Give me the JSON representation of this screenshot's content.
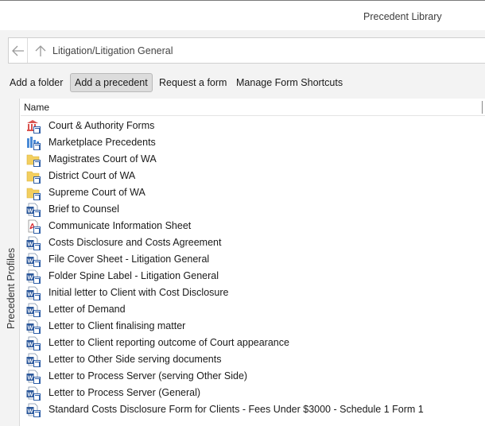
{
  "window": {
    "title": "Precedent Library"
  },
  "address": {
    "path": "Litigation/Litigation General"
  },
  "toolbar": {
    "add_folder": "Add a folder",
    "add_precedent": "Add a precedent",
    "request_form": "Request a form",
    "manage_shortcuts": "Manage Form Shortcuts"
  },
  "side_panel": {
    "label": "Precedent Profiles"
  },
  "list": {
    "column_name": "Name",
    "items": [
      {
        "label": "Court & Authority Forms",
        "icon": "court-building-icon"
      },
      {
        "label": "Marketplace Precedents",
        "icon": "marketplace-icon"
      },
      {
        "label": "Magistrates Court of WA",
        "icon": "folder-shortcut-icon"
      },
      {
        "label": "District Court of WA",
        "icon": "folder-shortcut-icon"
      },
      {
        "label": "Supreme Court of WA",
        "icon": "folder-shortcut-icon"
      },
      {
        "label": "Brief to Counsel",
        "icon": "word-doc-icon"
      },
      {
        "label": "Communicate Information Sheet",
        "icon": "pdf-doc-icon"
      },
      {
        "label": "Costs Disclosure and Costs Agreement",
        "icon": "word-doc-icon"
      },
      {
        "label": "File Cover Sheet - Litigation General",
        "icon": "word-doc-icon"
      },
      {
        "label": "Folder Spine Label - Litigation General",
        "icon": "word-doc-icon"
      },
      {
        "label": "Initial letter to Client with Cost Disclosure",
        "icon": "word-doc-icon"
      },
      {
        "label": "Letter of Demand",
        "icon": "word-doc-icon"
      },
      {
        "label": "Letter to Client finalising matter",
        "icon": "word-doc-icon"
      },
      {
        "label": "Letter to Client reporting outcome of Court appearance",
        "icon": "word-doc-icon"
      },
      {
        "label": "Letter to Other Side serving documents",
        "icon": "word-doc-icon"
      },
      {
        "label": "Letter to Process Server (serving Other Side)",
        "icon": "word-doc-icon"
      },
      {
        "label": "Letter to Process Server (General)",
        "icon": "word-doc-icon"
      },
      {
        "label": "Standard Costs Disclosure Form for Clients - Fees Under $3000 - Schedule 1 Form 1",
        "icon": "word-doc-icon"
      }
    ]
  },
  "colors": {
    "word_blue": "#2b579a",
    "pdf_red": "#d9262b",
    "folder_yellow": "#f3cf5f",
    "court_red": "#d9534f",
    "marketplace_blue": "#4a8ad6"
  }
}
